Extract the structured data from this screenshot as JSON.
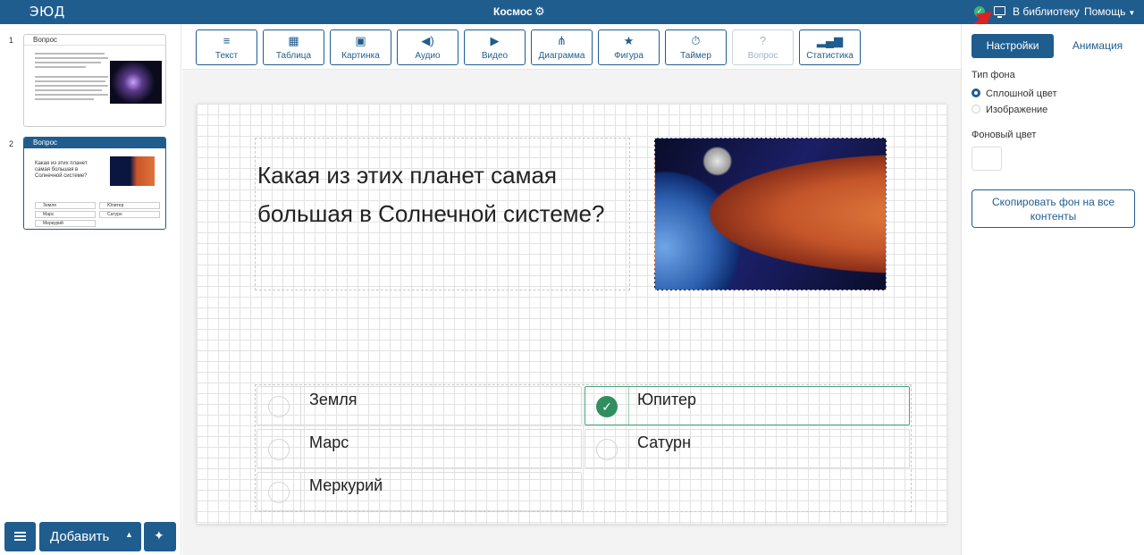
{
  "topbar": {
    "logo": "ЭЮД",
    "title": "Космос",
    "library_link": "В библиотеку",
    "help_menu": "Помощь"
  },
  "slides": [
    {
      "number": "1",
      "header": "Вопрос"
    },
    {
      "number": "2",
      "header": "Вопрос",
      "question": "Какая из этих планет самая большая в Солнечной системе?",
      "answers": [
        "Земля",
        "Юпитер",
        "Марс",
        "Сатурн",
        "Меркурий"
      ]
    }
  ],
  "bottom": {
    "add_label": "Добавить"
  },
  "toolbar": {
    "tools": [
      {
        "label": "Текст",
        "icon": "text-icon"
      },
      {
        "label": "Таблица",
        "icon": "table-icon"
      },
      {
        "label": "Картинка",
        "icon": "image-icon"
      },
      {
        "label": "Аудио",
        "icon": "audio-icon"
      },
      {
        "label": "Видео",
        "icon": "video-icon"
      },
      {
        "label": "Диаграмма",
        "icon": "diagram-icon"
      },
      {
        "label": "Фигура",
        "icon": "star-icon"
      },
      {
        "label": "Таймер",
        "icon": "timer-icon"
      },
      {
        "label": "Вопрос",
        "icon": "question-icon"
      },
      {
        "label": "Статистика",
        "icon": "bar-chart-icon"
      }
    ]
  },
  "canvas": {
    "question": "Какая из этих планет самая большая в Солнечной системе?",
    "answers": {
      "a1": "Земля",
      "a2": "Юпитер",
      "a3": "Марс",
      "a4": "Сатурн",
      "a5": "Меркурий"
    },
    "correct_answer": "Юпитер"
  },
  "right_panel": {
    "tab_settings": "Настройки",
    "tab_animation": "Анимация",
    "background_type_label": "Тип фона",
    "option_solid": "Сплошной цвет",
    "option_image": "Изображение",
    "selected_option": "Сплошной цвет",
    "background_color_label": "Фоновый цвет",
    "background_color": "#ffffff",
    "copy_button": "Скопировать фон на все контенты"
  },
  "colors": {
    "brand": "#1f5d8f",
    "correct": "#2f8f5e",
    "annotation_arrow": "#e02020"
  }
}
